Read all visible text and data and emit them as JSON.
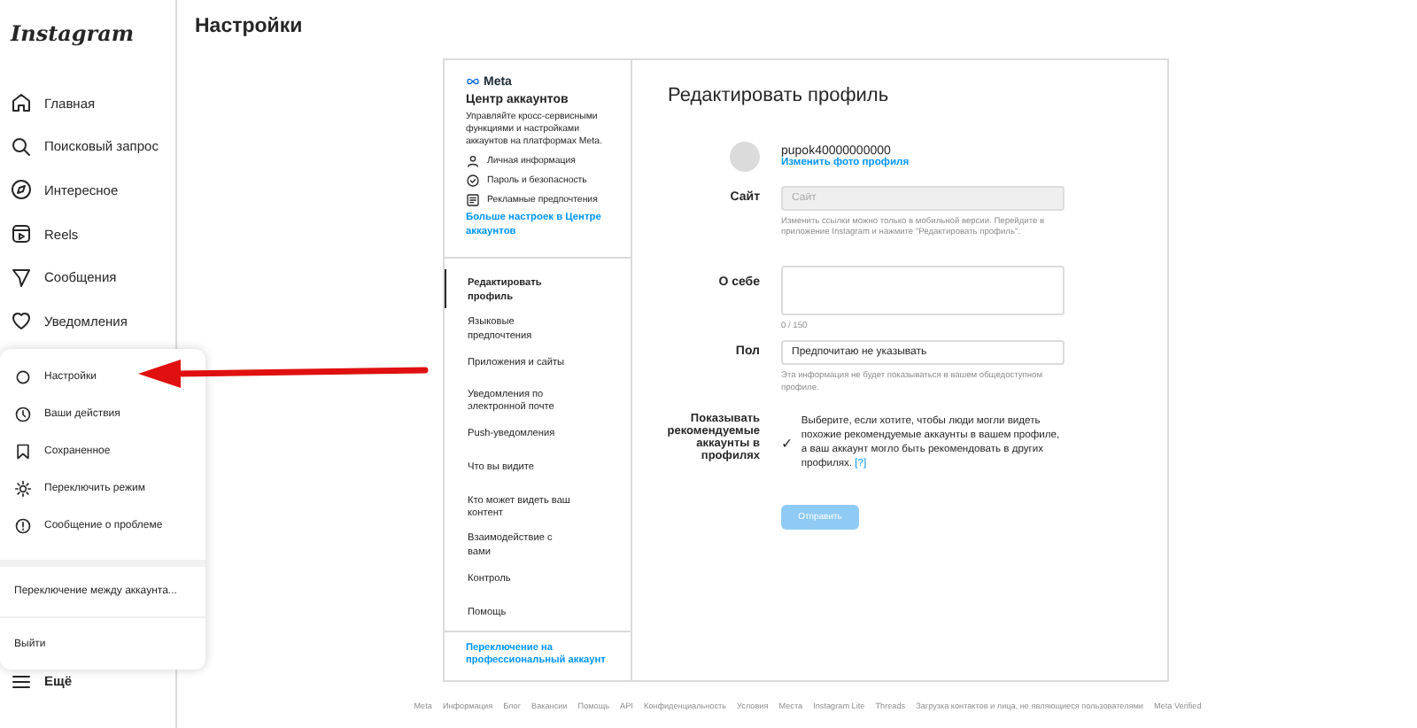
{
  "logo": "Instagram",
  "nav": [
    {
      "label": "Главная",
      "selected": false
    },
    {
      "label": "Поисковый запрос",
      "selected": false
    },
    {
      "label": "Интересное",
      "selected": false
    },
    {
      "label": "Reels",
      "selected": false
    },
    {
      "label": "Сообщения",
      "selected": false
    },
    {
      "label": "Уведомления",
      "selected": false
    }
  ],
  "more": {
    "label": "Ещё"
  },
  "popup": {
    "items": [
      {
        "label": "Настройки"
      },
      {
        "label": "Ваши действия"
      },
      {
        "label": "Сохраненное"
      },
      {
        "label": "Переключить режим"
      },
      {
        "label": "Сообщение о проблеме"
      }
    ],
    "switch_account": "Переключение между аккаунта...",
    "logout": "Выйти"
  },
  "page_title": "Настройки",
  "accounts_center": {
    "brand": "Meta",
    "title": "Центр аккаунтов",
    "description": "Управляйте кросс-сервисными функциями и настройками аккаунтов на платформах Meta.",
    "items": [
      {
        "label": "Личная информация"
      },
      {
        "label": "Пароль и безопасность"
      },
      {
        "label": "Рекламные предпочтения"
      }
    ],
    "link": "Больше настроек в Центре аккаунтов"
  },
  "settings_menu": [
    {
      "label": "Редактировать профиль",
      "selected": true
    },
    {
      "label": "Языковые предпочтения",
      "selected": false
    },
    {
      "label": "Приложения и сайты",
      "selected": false
    },
    {
      "label": "Уведомления по электронной почте",
      "selected": false
    },
    {
      "label": "Push-уведомления",
      "selected": false
    },
    {
      "label": "Что вы видите",
      "selected": false
    },
    {
      "label": "Кто может видеть ваш контент",
      "selected": false
    },
    {
      "label": "Взаимодействие с вами",
      "selected": false
    },
    {
      "label": "Контроль",
      "selected": false
    },
    {
      "label": "Помощь",
      "selected": false
    }
  ],
  "pro_link": "Переключение на профессиональный аккаунт",
  "form": {
    "title": "Редактировать профиль",
    "username": "pupok40000000000",
    "change_photo": "Изменить фото профиля",
    "site": {
      "label": "Сайт",
      "placeholder": "Сайт",
      "disabled": true,
      "hint": "Изменить ссылки можно только в мобильной версии. Перейдите в приложение Instagram и нажмите \"Редактировать профиль\"."
    },
    "bio": {
      "label": "О себе",
      "counter": "0 / 150"
    },
    "gender": {
      "label": "Пол",
      "value": "Предпочитаю не указывать",
      "hint": "Эта информация не будет показываться в вашем общедоступном профиле."
    },
    "recommend": {
      "label": "Показывать рекомендуемые аккаунты в профилях",
      "check": "✓",
      "text": "Выберите, если хотите, чтобы люди могли видеть похожие рекомендуемые аккаунты в вашем профиле, а ваш аккаунт могло быть рекомендовать в других профилях.",
      "help": "[?]",
      "checked": true
    },
    "submit": {
      "label": "Отправить",
      "disabled": true
    }
  },
  "footer": [
    "Meta",
    "Информация",
    "Блог",
    "Вакансии",
    "Помощь",
    "API",
    "Конфиденциальность",
    "Условия",
    "Места",
    "Instagram Lite",
    "Threads",
    "Загрузка контактов и лица, не являющиеся пользователями",
    "Meta Verified"
  ]
}
